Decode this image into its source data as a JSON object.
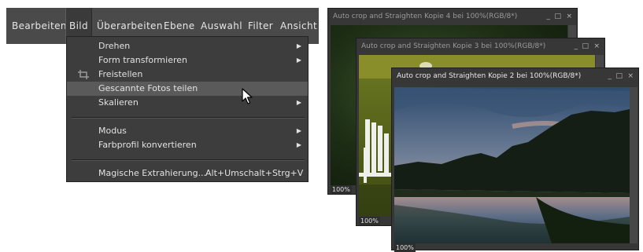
{
  "menubar": {
    "items": [
      {
        "label": "Bearbeiten"
      },
      {
        "label": "Bild"
      },
      {
        "label": "Überarbeiten"
      },
      {
        "label": "Ebene"
      },
      {
        "label": "Auswahl"
      },
      {
        "label": "Filter"
      },
      {
        "label": "Ansicht"
      }
    ]
  },
  "menu": {
    "items": [
      {
        "label": "Drehen",
        "submenu": true
      },
      {
        "label": "Form transformieren",
        "submenu": true
      },
      {
        "label": "Freistellen",
        "icon": "crop-icon"
      },
      {
        "label": "Gescannte Fotos teilen",
        "highlighted": true
      },
      {
        "label": "Skalieren",
        "submenu": true
      },
      {
        "label": "Modus",
        "submenu": true
      },
      {
        "label": "Farbprofil konvertieren",
        "submenu": true
      },
      {
        "label": "Magische Extrahierung...",
        "shortcut": "Alt+Umschalt+Strg+V"
      }
    ],
    "arrow_glyph": "▶"
  },
  "windows": [
    {
      "title": "Auto crop and Straighten Kopie 4 bei 100%(RGB/8*)",
      "zoom": "100%",
      "controls": [
        "_",
        "□",
        "×"
      ]
    },
    {
      "title": "Auto crop and Straighten Kopie 3 bei 100%(RGB/8*)",
      "zoom": "100%",
      "controls": [
        "_",
        "□",
        "×"
      ]
    },
    {
      "title": "Auto crop and Straighten Kopie 2 bei 100%(RGB/8*)",
      "zoom": "100%",
      "controls": [
        "_",
        "□",
        "×"
      ]
    }
  ],
  "colors": {
    "menubar_bg": "#4a4a4a",
    "menu_bg": "#3d3d3d",
    "highlight": "#5a5a5a",
    "window_bg": "#373737"
  }
}
